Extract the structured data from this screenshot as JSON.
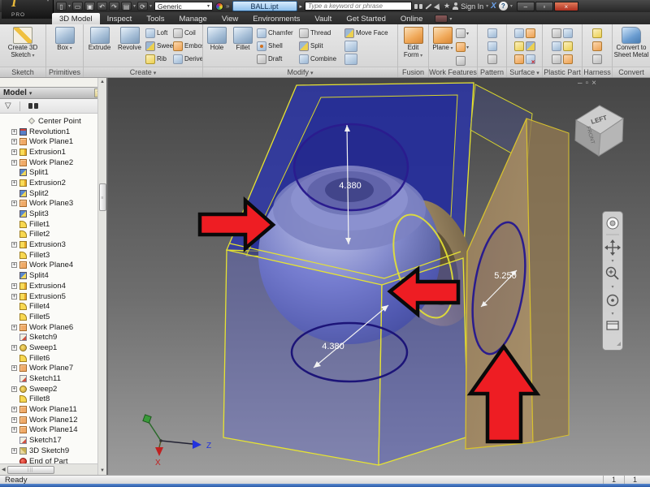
{
  "titlebar": {
    "logo_sub": "PRO",
    "material": "Generic",
    "doc_title": "BALL.ipt",
    "search_placeholder": "Type a keyword or phrase",
    "sign_in": "Sign In"
  },
  "tabs": {
    "items": [
      "3D Model",
      "Inspect",
      "Tools",
      "Manage",
      "View",
      "Environments",
      "Vault",
      "Get Started",
      "Online"
    ],
    "active": "3D Model"
  },
  "ribbon": {
    "panels": {
      "sketch": {
        "caption": "Sketch",
        "create_3d_sketch": "Create 3D Sketch"
      },
      "primitives": {
        "caption": "Primitives",
        "box": "Box"
      },
      "create": {
        "caption": "Create",
        "extrude": "Extrude",
        "revolve": "Revolve",
        "loft": "Loft",
        "sweep": "Sweep",
        "rib": "Rib",
        "coil": "Coil",
        "emboss": "Emboss",
        "derive": "Derive"
      },
      "modify": {
        "caption": "Modify",
        "hole": "Hole",
        "fillet": "Fillet",
        "chamfer": "Chamfer",
        "shell": "Shell",
        "draft": "Draft",
        "thread": "Thread",
        "split": "Split",
        "combine": "Combine",
        "move_face": "Move Face"
      },
      "fusion": {
        "caption": "Fusion",
        "edit_form": "Edit Form"
      },
      "work_features": {
        "caption": "Work Features",
        "plane": "Plane"
      },
      "pattern": {
        "caption": "Pattern"
      },
      "surface": {
        "caption": "Surface"
      },
      "plastic_part": {
        "caption": "Plastic Part"
      },
      "harness": {
        "caption": "Harness"
      },
      "convert": {
        "caption": "Convert",
        "convert_to_sheet_metal": "Convert to Sheet Metal"
      }
    }
  },
  "browser": {
    "title": "Model",
    "items": [
      {
        "label": "Center Point",
        "icon": "center-point",
        "plus": false,
        "indent": 2
      },
      {
        "label": "Revolution1",
        "icon": "revolution",
        "plus": true,
        "indent": 1
      },
      {
        "label": "Work Plane1",
        "icon": "work-plane",
        "plus": true,
        "indent": 1
      },
      {
        "label": "Extrusion1",
        "icon": "extrusion",
        "plus": true,
        "indent": 1
      },
      {
        "label": "Work Plane2",
        "icon": "work-plane",
        "plus": true,
        "indent": 1
      },
      {
        "label": "Split1",
        "icon": "split",
        "plus": false,
        "indent": 1
      },
      {
        "label": "Extrusion2",
        "icon": "extrusion",
        "plus": true,
        "indent": 1
      },
      {
        "label": "Split2",
        "icon": "split",
        "plus": false,
        "indent": 1
      },
      {
        "label": "Work Plane3",
        "icon": "work-plane",
        "plus": true,
        "indent": 1
      },
      {
        "label": "Split3",
        "icon": "split",
        "plus": false,
        "indent": 1
      },
      {
        "label": "Fillet1",
        "icon": "fillet",
        "plus": false,
        "indent": 1
      },
      {
        "label": "Fillet2",
        "icon": "fillet",
        "plus": false,
        "indent": 1
      },
      {
        "label": "Extrusion3",
        "icon": "extrusion",
        "plus": true,
        "indent": 1
      },
      {
        "label": "Fillet3",
        "icon": "fillet",
        "plus": false,
        "indent": 1
      },
      {
        "label": "Work Plane4",
        "icon": "work-plane",
        "plus": true,
        "indent": 1
      },
      {
        "label": "Split4",
        "icon": "split",
        "plus": false,
        "indent": 1
      },
      {
        "label": "Extrusion4",
        "icon": "extrusion",
        "plus": true,
        "indent": 1
      },
      {
        "label": "Extrusion5",
        "icon": "extrusion",
        "plus": true,
        "indent": 1
      },
      {
        "label": "Fillet4",
        "icon": "fillet",
        "plus": false,
        "indent": 1
      },
      {
        "label": "Fillet5",
        "icon": "fillet",
        "plus": false,
        "indent": 1
      },
      {
        "label": "Work Plane6",
        "icon": "work-plane",
        "plus": true,
        "indent": 1
      },
      {
        "label": "Sketch9",
        "icon": "sketch",
        "plus": false,
        "indent": 1
      },
      {
        "label": "Sweep1",
        "icon": "sweep",
        "plus": true,
        "indent": 1
      },
      {
        "label": "Fillet6",
        "icon": "fillet",
        "plus": false,
        "indent": 1
      },
      {
        "label": "Work Plane7",
        "icon": "work-plane",
        "plus": true,
        "indent": 1
      },
      {
        "label": "Sketch11",
        "icon": "sketch",
        "plus": false,
        "indent": 1
      },
      {
        "label": "Sweep2",
        "icon": "sweep",
        "plus": true,
        "indent": 1
      },
      {
        "label": "Fillet8",
        "icon": "fillet",
        "plus": false,
        "indent": 1
      },
      {
        "label": "Work Plane11",
        "icon": "work-plane",
        "plus": true,
        "indent": 1
      },
      {
        "label": "Work Plane12",
        "icon": "work-plane",
        "plus": true,
        "indent": 1
      },
      {
        "label": "Work Plane14",
        "icon": "work-plane",
        "plus": true,
        "indent": 1
      },
      {
        "label": "Sketch17",
        "icon": "sketch",
        "plus": false,
        "indent": 1
      },
      {
        "label": "3D Sketch9",
        "icon": "sketch-3d",
        "plus": true,
        "indent": 1
      },
      {
        "label": "End of Part",
        "icon": "end-of-part",
        "plus": false,
        "indent": 1
      }
    ]
  },
  "viewport": {
    "dimensions": {
      "top": "4.380",
      "bottom": "4.380",
      "right": "5.250"
    },
    "viewcube": {
      "top": "LEFT",
      "side": "FRONT"
    },
    "axes": {
      "z": "Z",
      "x": "X"
    }
  },
  "statusbar": {
    "message": "Ready",
    "cell1": "1",
    "cell2": "1"
  },
  "colors": {
    "annotation_arrow_red": "#ee1d23",
    "plane_edge_yellow": "#e6e332",
    "sketch_navy": "#2a1c8e",
    "doc_tab_blue": "#8fc0ea"
  }
}
